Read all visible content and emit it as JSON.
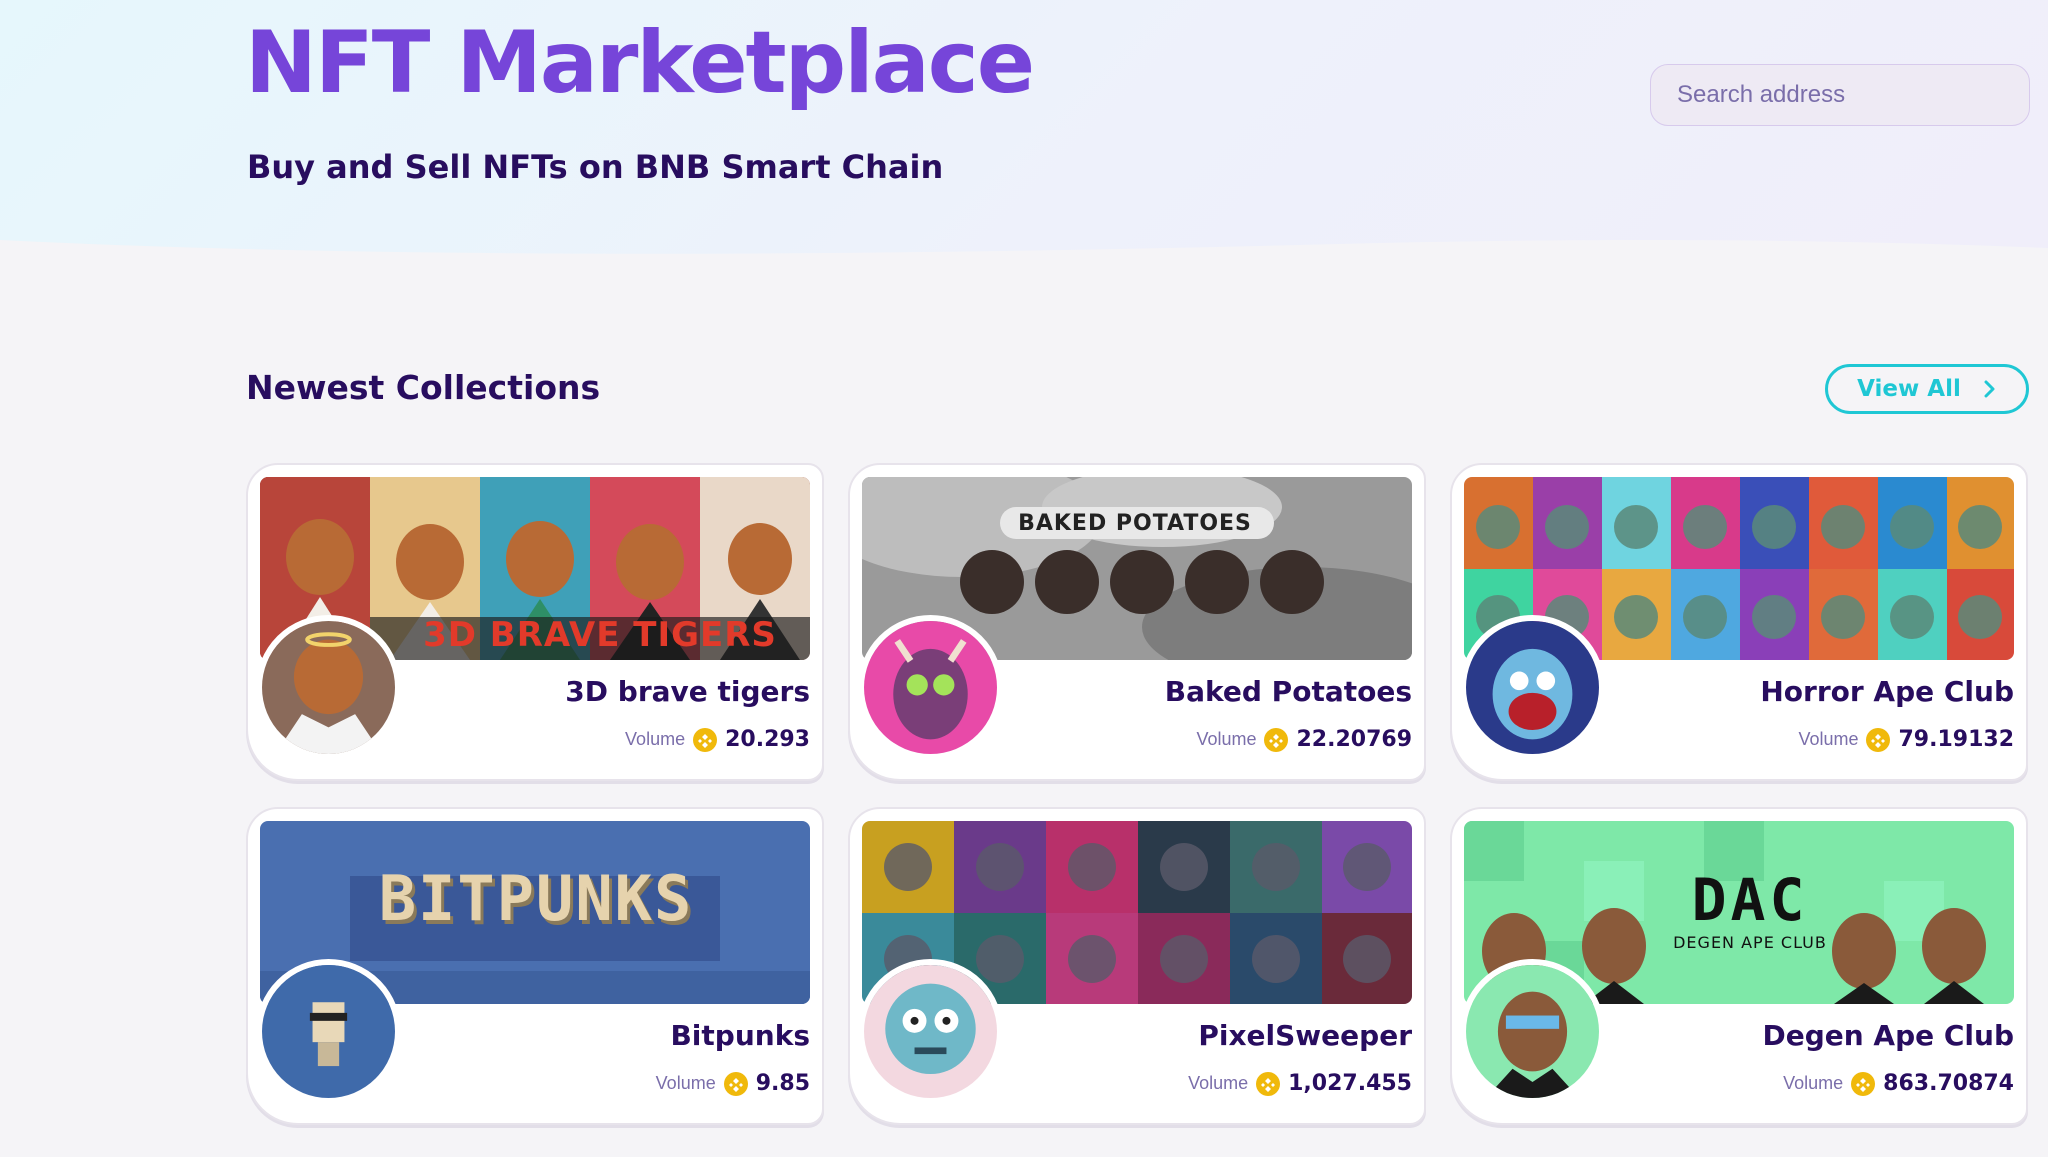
{
  "header": {
    "title": "NFT Marketplace",
    "subtitle": "Buy and Sell NFTs on BNB Smart Chain",
    "search_placeholder": "Search address"
  },
  "newest": {
    "title": "Newest Collections",
    "view_all_label": "View All"
  },
  "collections": [
    {
      "name": "3D brave tigers",
      "volume_label": "Volume",
      "volume": "20.293",
      "banner_text": "3D BRAVE TIGERS"
    },
    {
      "name": "Baked Potatoes",
      "volume_label": "Volume",
      "volume": "22.20769",
      "banner_text": "BAKED POTATOES"
    },
    {
      "name": "Horror Ape Club",
      "volume_label": "Volume",
      "volume": "79.19132"
    },
    {
      "name": "Bitpunks",
      "volume_label": "Volume",
      "volume": "9.85",
      "banner_text": "BITPUNKS"
    },
    {
      "name": "PixelSweeper",
      "volume_label": "Volume",
      "volume": "1,027.455"
    },
    {
      "name": "Degen Ape Club",
      "volume_label": "Volume",
      "volume": "863.70874",
      "banner_text": "DAC",
      "banner_subtext": "DEGEN APE CLUB"
    }
  ],
  "colors": {
    "accent": "#7645d9",
    "text": "#280d5f",
    "secondary": "#1fc7d4",
    "subtle": "#7a6eaa",
    "bnb": "#f0b90b"
  },
  "icons": {
    "view_all": "chevron-right-icon",
    "volume": "bnb-token-icon"
  }
}
